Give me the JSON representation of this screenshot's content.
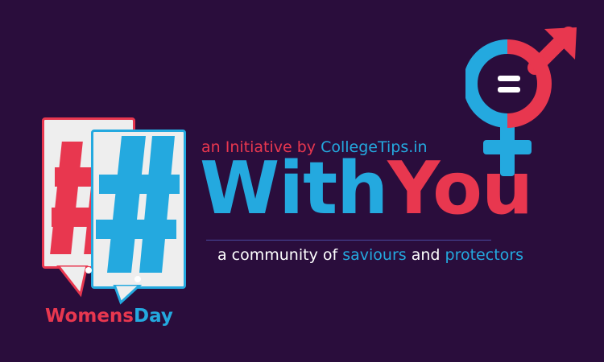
{
  "initiative": {
    "prefix": "an Initiative by",
    "org": "CollegeTips.in"
  },
  "headline": {
    "part1": "With",
    "part2": "You"
  },
  "subtitle": {
    "prefix": "a community of",
    "word1": "saviours",
    "joiner": "and",
    "word2": "protectors"
  },
  "hashtag": {
    "part1": "Womens",
    "part2": "Day"
  },
  "icons": {
    "hash_cards": "hashtag-icon",
    "gender_symbol": "gender-equality-icon"
  },
  "colors": {
    "background": "#2a0d3c",
    "pink": "#e8374f",
    "blue": "#24a9df",
    "white": "#ffffff"
  }
}
